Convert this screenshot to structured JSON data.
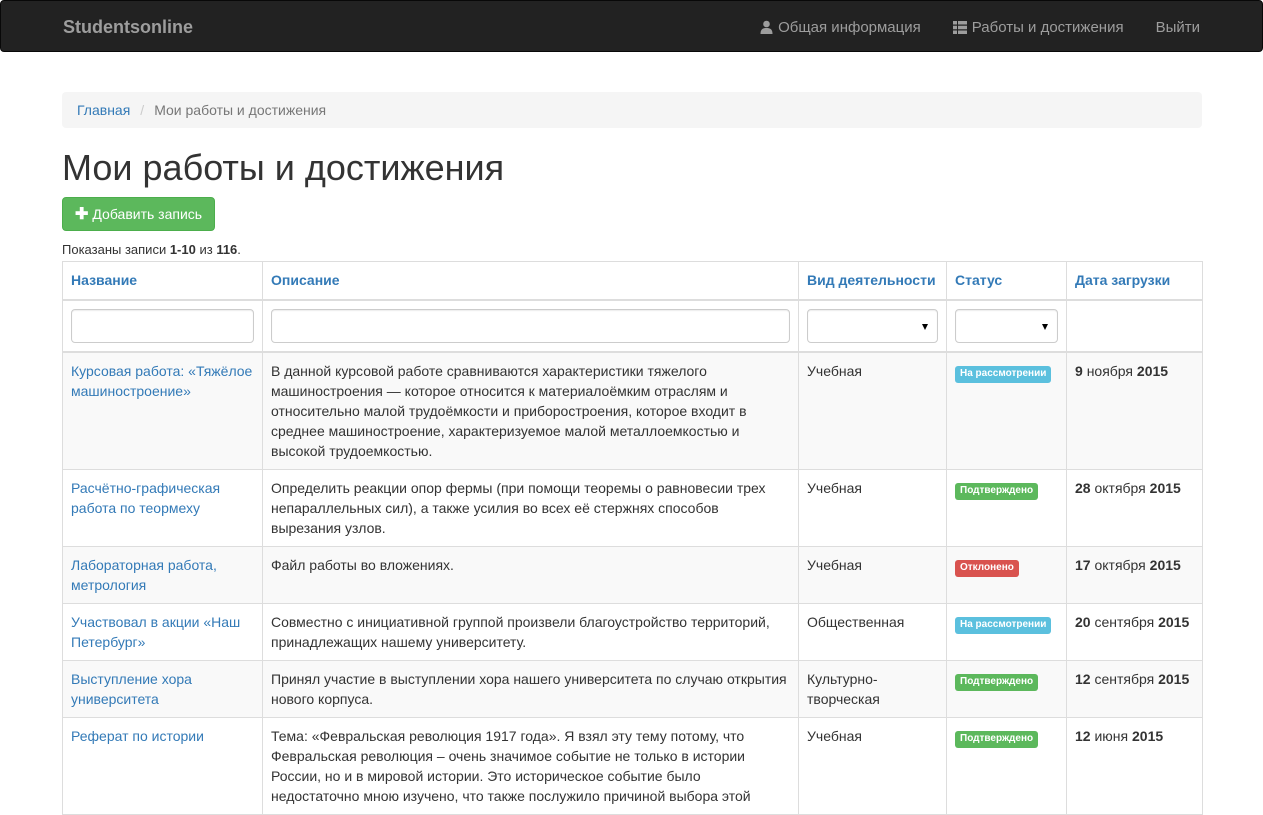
{
  "navbar": {
    "brand": "Studentsonline",
    "links": [
      {
        "label": "Общая информация",
        "icon": "user-icon"
      },
      {
        "label": "Работы и достижения",
        "icon": "list-icon"
      },
      {
        "label": "Выйти",
        "icon": ""
      }
    ]
  },
  "breadcrumb": {
    "home": "Главная",
    "separator": "/",
    "current": "Мои работы и достижения"
  },
  "page": {
    "title": "Мои работы и достижения",
    "add_button": "Добавить запись",
    "summary": {
      "prefix": "Показаны записи ",
      "range": "1-10",
      "middle": " из ",
      "total": "116",
      "suffix": "."
    }
  },
  "table": {
    "columns": [
      "Название",
      "Описание",
      "Вид деятельности",
      "Статус",
      "Дата загрузки"
    ],
    "rows": [
      {
        "title": "Курсовая работа: «Тяжёлое машиностроение»",
        "description": "В данной курсовой работе сравниваются характеристики тяжелого машиностроения — которое относится к материалоёмким отраслям и относительно малой трудоёмкости и приборостроения, которое входит в среднее машиностроение, характеризуемое малой металлоемкостью и высокой трудоемкостью.",
        "activity": "Учебная",
        "status": "На рассмотрении",
        "status_type": "info",
        "day": "9",
        "month": "ноября",
        "year": "2015"
      },
      {
        "title": "Расчётно-графическая работа по теормеху",
        "description": "Определить реакции опор фермы (при помощи теоремы о равновесии трех непараллельных сил), а также усилия во всех её стержнях способов вырезания узлов.",
        "activity": "Учебная",
        "status": "Подтверждено",
        "status_type": "success",
        "day": "28",
        "month": "октября",
        "year": "2015"
      },
      {
        "title": "Лабораторная работа, метрология",
        "description": "Файл работы во вложениях.",
        "activity": "Учебная",
        "status": "Отклонено",
        "status_type": "danger",
        "day": "17",
        "month": "октября",
        "year": "2015"
      },
      {
        "title": "Участвовал в акции «Наш Петербург»",
        "description": "Совместно с инициативной группой произвели благоустройство территорий, принадлежащих нашему университету.",
        "activity": "Общественная",
        "status": "На рассмотрении",
        "status_type": "info",
        "day": "20",
        "month": "сентября",
        "year": "2015"
      },
      {
        "title": "Выступление хора университета",
        "description": "Принял участие в выступлении хора нашего университета по случаю открытия нового корпуса.",
        "activity": "Культурно-творческая",
        "status": "Подтверждено",
        "status_type": "success",
        "day": "12",
        "month": "сентября",
        "year": "2015"
      },
      {
        "title": "Реферат по истории",
        "description": "Тема: «Февральская революция 1917 года». Я взял эту тему потому, что Февральская революция – очень значимое событие не только в истории России, но и в мировой истории. Это историческое событие было недостаточно мною изучено, что также послужило причиной выбора этой",
        "activity": "Учебная",
        "status": "Подтверждено",
        "status_type": "success",
        "day": "12",
        "month": "июня",
        "year": "2015"
      }
    ]
  },
  "colors": {
    "navbar_bg": "#222222",
    "link": "#337ab7",
    "success": "#5cb85c",
    "info": "#5bc0de",
    "danger": "#d9534f"
  }
}
